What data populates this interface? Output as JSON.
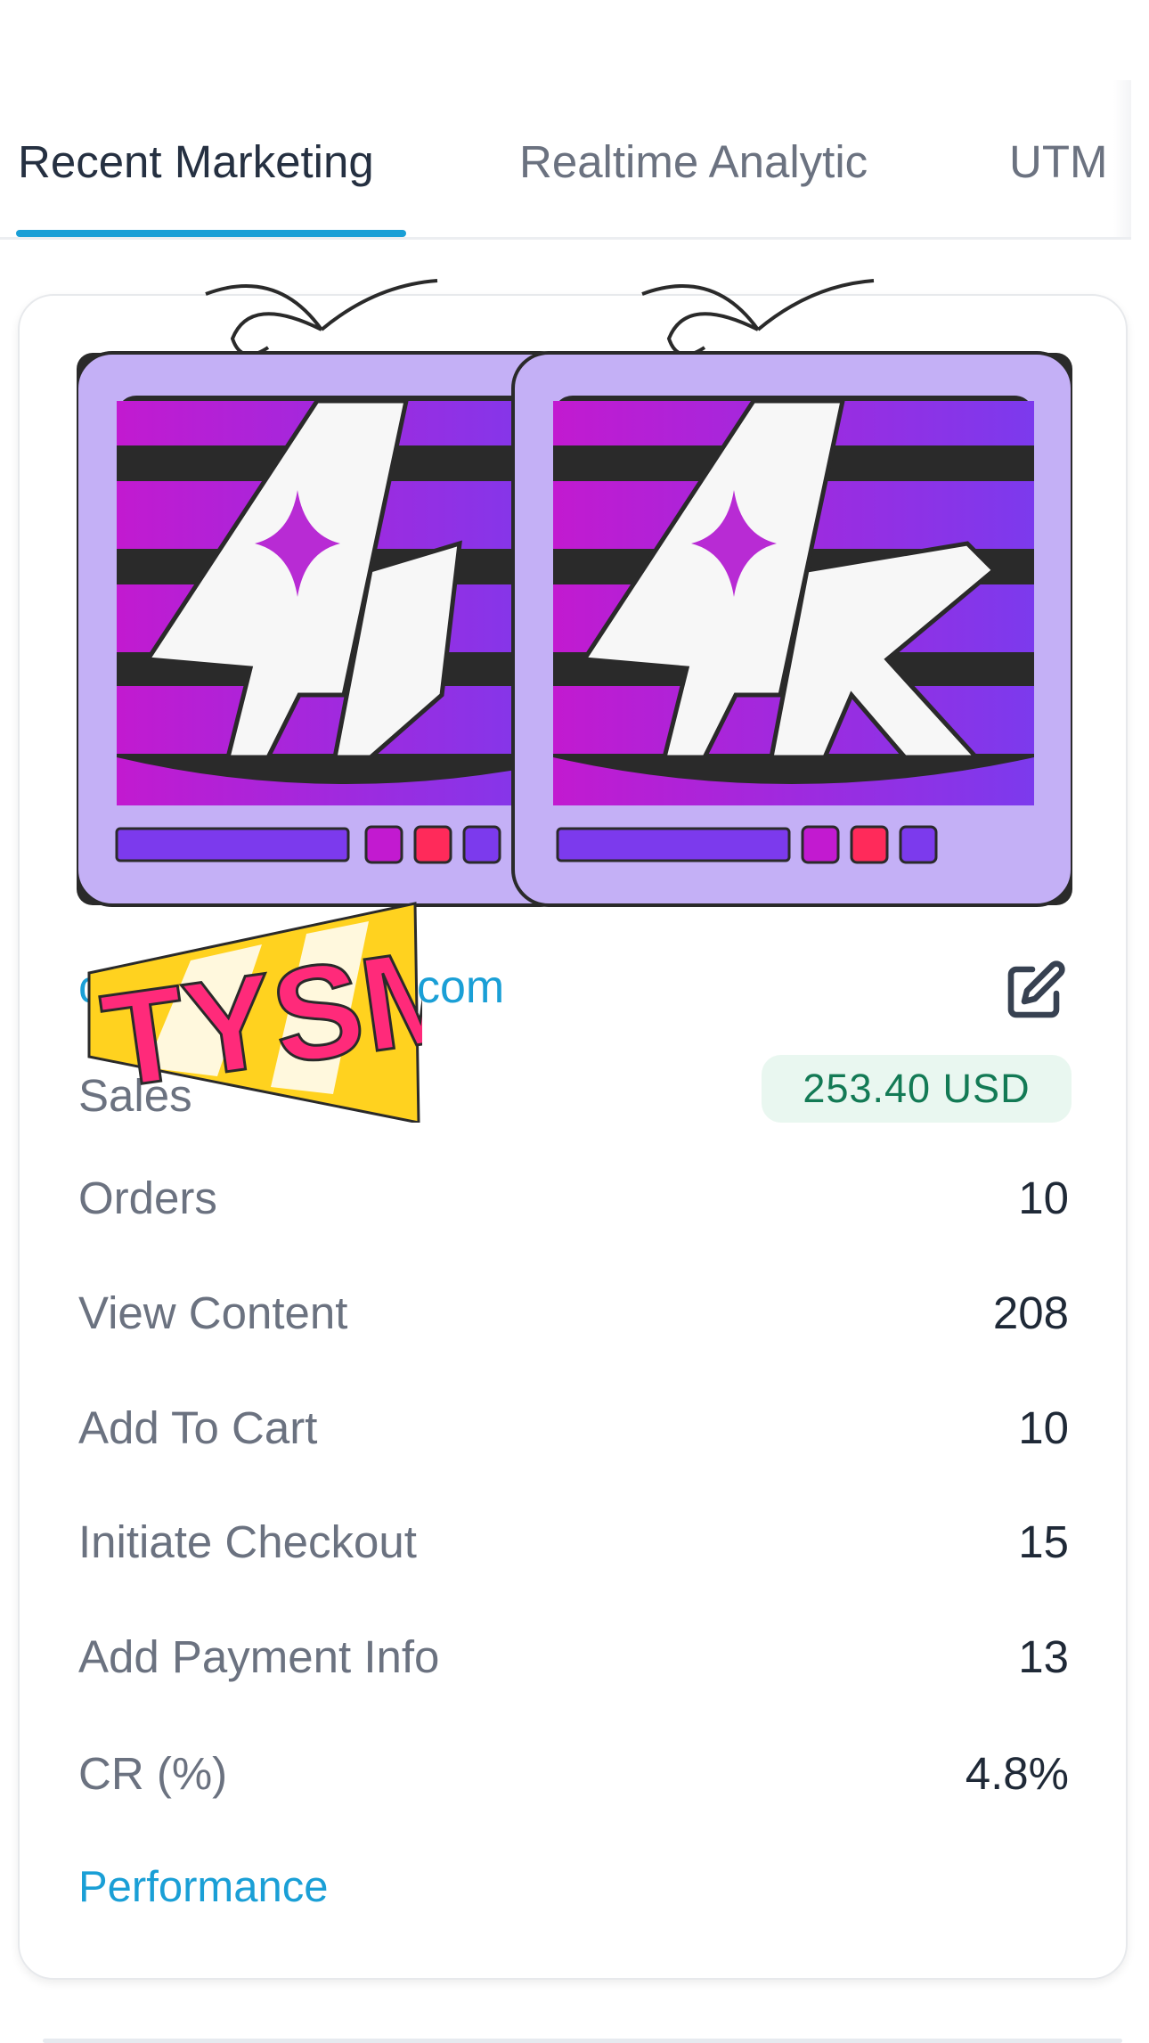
{
  "tabs": [
    {
      "label": "Recent Marketing",
      "active": true
    },
    {
      "label": "Realtime Analytic",
      "active": false
    },
    {
      "label": "UTM",
      "active": false
    }
  ],
  "card": {
    "site_link_visible": "com",
    "sticker_text": "TYSM",
    "artwork_text": "4k",
    "metrics": [
      {
        "label": "Sales",
        "value": "253.40 USD"
      },
      {
        "label": "Orders",
        "value": "10"
      },
      {
        "label": "View Content",
        "value": "208"
      },
      {
        "label": "Add To Cart",
        "value": "10"
      },
      {
        "label": "Initiate Checkout",
        "value": "15"
      },
      {
        "label": "Add Payment Info",
        "value": "13"
      },
      {
        "label": "CR (%)",
        "value": "4.8%"
      }
    ],
    "performance_link": "Performance"
  },
  "icons": {
    "edit": "edit-icon"
  },
  "colors": {
    "accent": "#1a9fd6",
    "tab_active": "#253041",
    "text_muted": "#6b7280",
    "text_dark": "#1f2937",
    "badge_bg": "#e9f7f0",
    "badge_text": "#137a55",
    "tv_lilac": "#c4b0f6",
    "stripe_magenta": "#c21ad0",
    "stripe_purple": "#7c3aed",
    "sticker_yellow": "#ffd21f",
    "sticker_pink": "#ff2a7a"
  }
}
